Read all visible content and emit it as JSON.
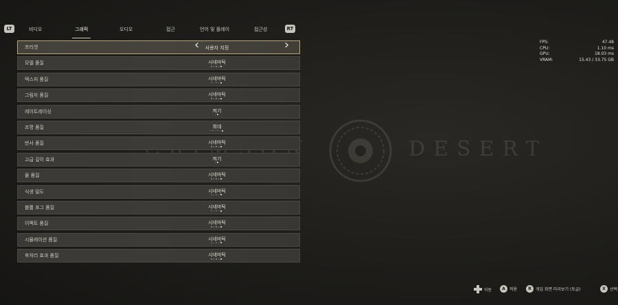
{
  "background": {
    "logo_left": "CRIMSON",
    "logo_right": "DESERT"
  },
  "tabs": {
    "lt": "LT",
    "rt": "RT",
    "items": [
      "비디오",
      "그래픽",
      "오디오",
      "접근",
      "언어 및 플레이",
      "접근성"
    ],
    "active_index": 1
  },
  "settings": [
    {
      "label": "프리셋",
      "value": "사용자 지정",
      "dots": 0,
      "selected": true
    },
    {
      "label": "모델 품질",
      "value": "시네마틱",
      "dots": 5,
      "level": 5
    },
    {
      "label": "텍스처 품질",
      "value": "시네마틱",
      "dots": 5,
      "level": 5
    },
    {
      "label": "그림자 품질",
      "value": "시네마틱",
      "dots": 5,
      "level": 5
    },
    {
      "label": "레이트레이싱",
      "value": "켜기",
      "dots": 2,
      "level": 2
    },
    {
      "label": "조명 품질",
      "value": "최대",
      "dots": 6,
      "level": 6
    },
    {
      "label": "반사 품질",
      "value": "시네마틱",
      "dots": 5,
      "level": 5
    },
    {
      "label": "고급 깊이 효과",
      "value": "켜기",
      "dots": 2,
      "level": 2
    },
    {
      "label": "물 품질",
      "value": "시네마틱",
      "dots": 5,
      "level": 5
    },
    {
      "label": "식생 밀도",
      "value": "시네마틱",
      "dots": 5,
      "level": 5
    },
    {
      "label": "볼륨 포그 품질",
      "value": "시네마틱",
      "dots": 5,
      "level": 5
    },
    {
      "label": "이펙트 품질",
      "value": "시네마틱",
      "dots": 5,
      "level": 5
    },
    {
      "label": "시뮬레이션 품질",
      "value": "시네마틱",
      "dots": 5,
      "level": 5
    },
    {
      "label": "후처리 효과 품질",
      "value": "시네마틱",
      "dots": 5,
      "level": 5
    }
  ],
  "perf": [
    {
      "key": "FPS:",
      "value": "47.48"
    },
    {
      "key": "CPU:",
      "value": "1.10 ms"
    },
    {
      "key": "GPU:",
      "value": "18.03 ms"
    },
    {
      "key": "VRAM:",
      "value": "15.43 / 33.75 GB"
    }
  ],
  "hints": {
    "move": "이동",
    "apply_button": "A",
    "apply": "적용",
    "preview_button": "R",
    "preview": "게임 화면 미리보기 (토글)",
    "select_button": "X",
    "select": "선택"
  },
  "colors": {
    "selected_border": "#b9a67c",
    "row_bg": "#3d3b37",
    "screen_bg": "#1c1b19"
  }
}
